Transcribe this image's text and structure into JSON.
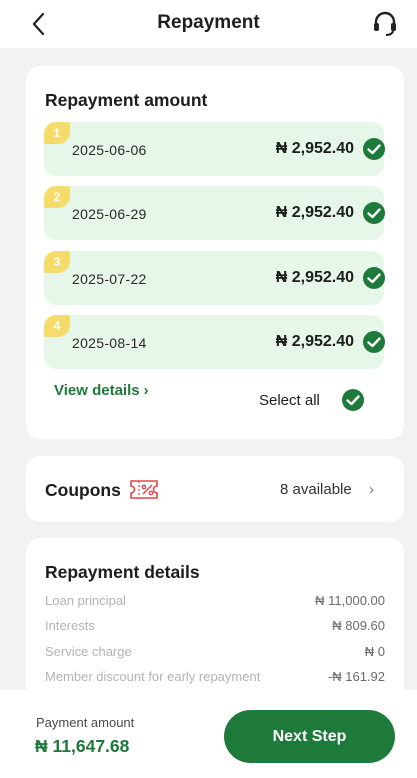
{
  "header": {
    "title": "Repayment"
  },
  "repayment_amount": {
    "title": "Repayment amount",
    "installments": [
      {
        "number": "1",
        "date": "2025-06-06",
        "amount": "₦ 2,952.40"
      },
      {
        "number": "2",
        "date": "2025-06-29",
        "amount": "₦ 2,952.40"
      },
      {
        "number": "3",
        "date": "2025-07-22",
        "amount": "₦ 2,952.40"
      },
      {
        "number": "4",
        "date": "2025-08-14",
        "amount": "₦ 2,952.40"
      }
    ],
    "view_details": "View details",
    "select_all": "Select all"
  },
  "coupons": {
    "label": "Coupons",
    "available": "8 available",
    "icon": "coupon-percent-icon"
  },
  "details": {
    "title": "Repayment details",
    "rows": [
      {
        "label": "Loan principal",
        "value": "₦ 11,000.00"
      },
      {
        "label": "Interests",
        "value": "₦ 809.60"
      },
      {
        "label": "Service charge",
        "value": "₦ 0"
      },
      {
        "label": "Member discount for early repayment",
        "value": "-₦ 161.92"
      }
    ]
  },
  "footer": {
    "payment_label": "Payment amount",
    "payment_amount": "₦ 11,647.68",
    "next_label": "Next Step"
  },
  "colors": {
    "primary": "#1e7a3a",
    "installment_bg": "#e6f6e9",
    "badge": "#f5dc6a",
    "coupon_red": "#e0474c"
  }
}
